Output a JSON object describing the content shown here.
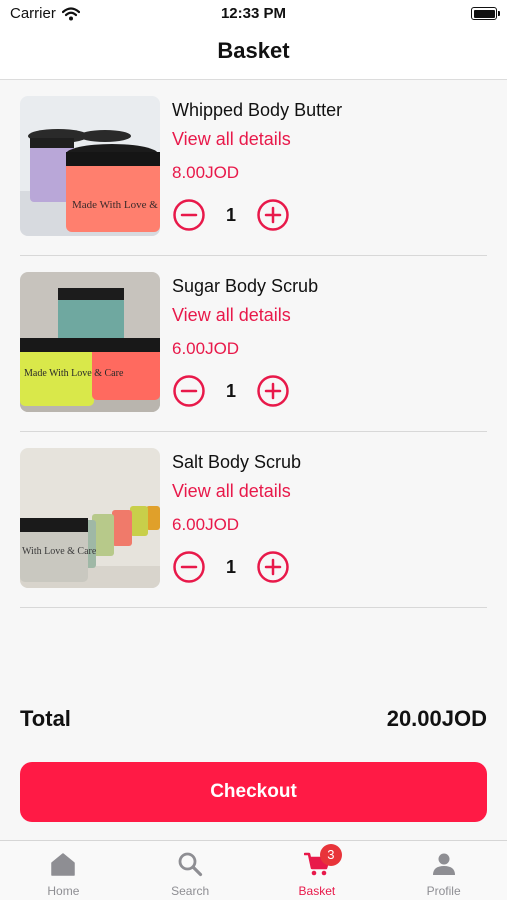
{
  "status_bar": {
    "carrier": "Carrier",
    "time": "12:33 PM"
  },
  "header": {
    "title": "Basket"
  },
  "accent_color": "#e8194a",
  "items": [
    {
      "name": "Whipped Body Butter",
      "link": "View all details",
      "price": "8.00JOD",
      "quantity": "1",
      "image_label": "Made With Love & Care"
    },
    {
      "name": "Sugar Body Scrub",
      "link": "View all details",
      "price": "6.00JOD",
      "quantity": "1",
      "image_label": "Made With Love & Care"
    },
    {
      "name": "Salt Body Scrub",
      "link": "View all details",
      "price": "6.00JOD",
      "quantity": "1",
      "image_label": "With Love & Care"
    }
  ],
  "total": {
    "label": "Total",
    "value": "20.00JOD"
  },
  "checkout": {
    "label": "Checkout"
  },
  "tab_bar": {
    "items": [
      {
        "label": "Home",
        "icon": "home-icon"
      },
      {
        "label": "Search",
        "icon": "search-icon"
      },
      {
        "label": "Basket",
        "icon": "cart-icon",
        "badge": "3",
        "active": true
      },
      {
        "label": "Profile",
        "icon": "person-icon"
      }
    ]
  }
}
